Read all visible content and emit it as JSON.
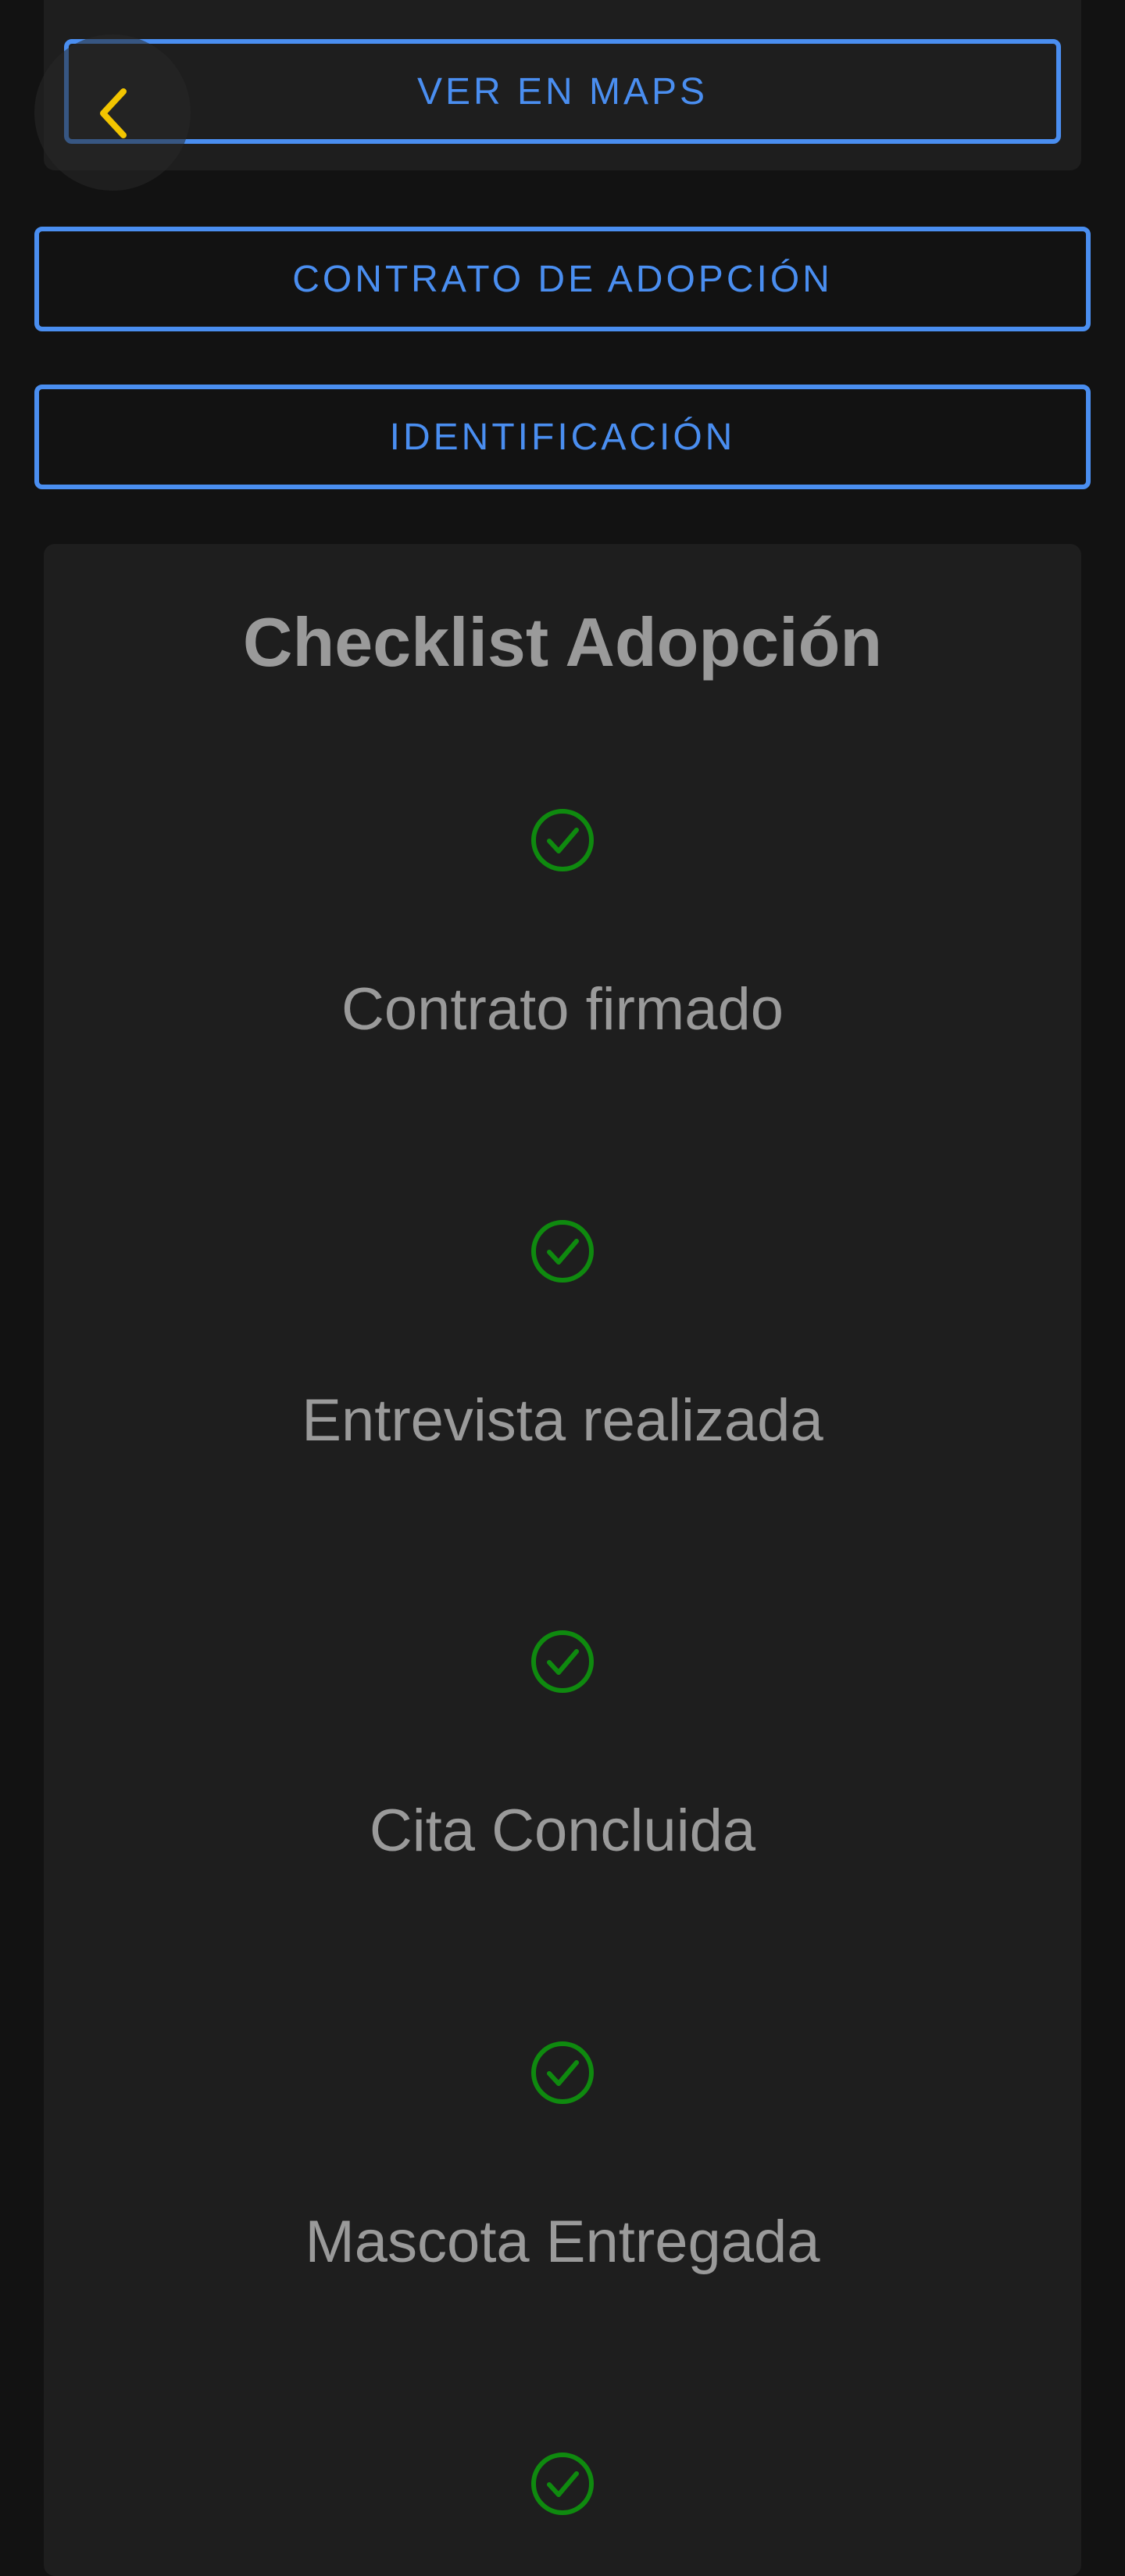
{
  "buttons": {
    "maps_label": "VER EN MAPS",
    "contract_label": "CONTRATO DE ADOPCIÓN",
    "identification_label": "IDENTIFICACIÓN"
  },
  "back_icon": "chevron-left-icon",
  "checklist": {
    "title": "Checklist Adopción",
    "items": [
      {
        "label": "Contrato firmado",
        "icon": "check-circle-icon",
        "checked": true
      },
      {
        "label": "Entrevista realizada",
        "icon": "check-circle-icon",
        "checked": true
      },
      {
        "label": "Cita Concluida",
        "icon": "check-circle-icon",
        "checked": true
      },
      {
        "label": "Mascota Entregada",
        "icon": "check-circle-icon",
        "checked": true
      },
      {
        "label": "",
        "icon": "check-circle-icon",
        "checked": true
      }
    ]
  },
  "colors": {
    "background": "#121212",
    "card": "#1e1e1e",
    "accent_blue": "#4a8ef0",
    "back_chevron": "#f2c500",
    "check_green": "#0f8a0f",
    "text_gray": "#9a9a9a"
  }
}
